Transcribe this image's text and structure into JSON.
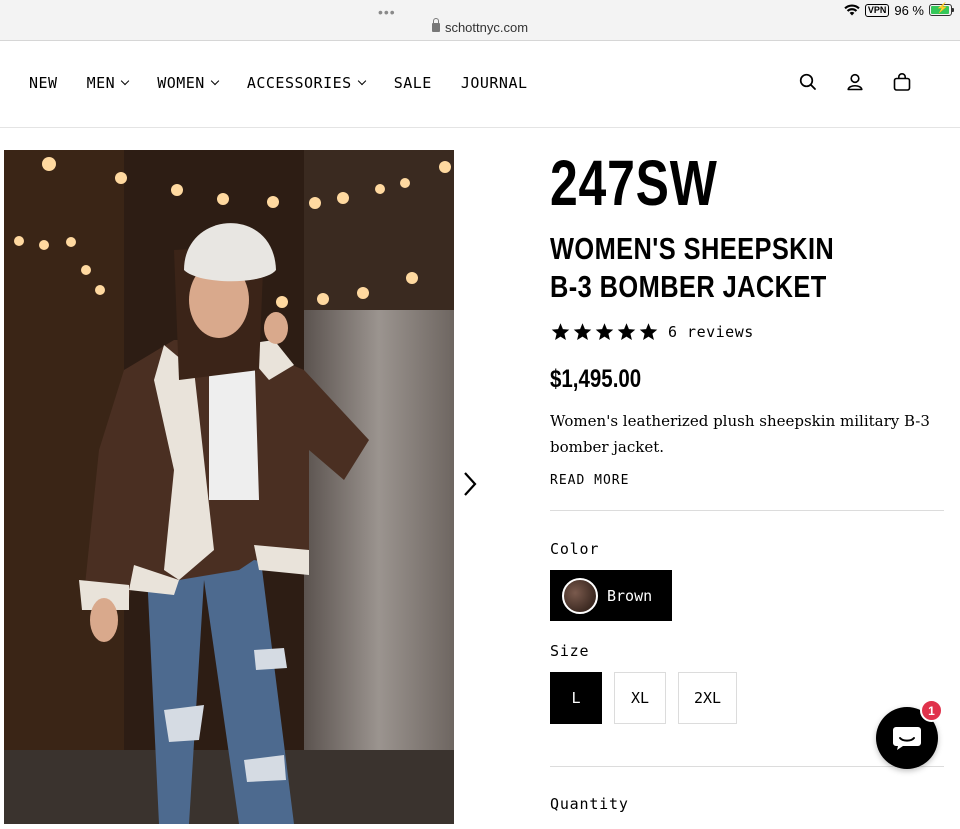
{
  "browser": {
    "dots": "•••",
    "url": "schottnyc.com",
    "vpn": "VPN",
    "battery": "96 %",
    "battery_level": 0.96
  },
  "nav": {
    "items": [
      {
        "label": "NEW",
        "has_dropdown": false
      },
      {
        "label": "MEN",
        "has_dropdown": true
      },
      {
        "label": "WOMEN",
        "has_dropdown": true
      },
      {
        "label": "ACCESSORIES",
        "has_dropdown": true
      },
      {
        "label": "SALE",
        "has_dropdown": false
      },
      {
        "label": "JOURNAL",
        "has_dropdown": false
      }
    ],
    "icons": [
      "search-icon",
      "account-icon",
      "cart-icon"
    ]
  },
  "product": {
    "model": "247SW",
    "title_line1": "WOMEN'S SHEEPSKIN",
    "title_line2": "B-3 BOMBER JACKET",
    "rating": 5,
    "reviews": "6 reviews",
    "price": "$1,495.00",
    "description": "Women's leatherized plush sheepskin military B-3 bomber jacket.",
    "read_more": "READ MORE",
    "color_label": "Color",
    "color": "Brown",
    "size_label": "Size",
    "sizes": [
      "L",
      "XL",
      "2XL"
    ],
    "selected_size": "L",
    "quantity_label": "Quantity"
  },
  "chat": {
    "badge": "1"
  },
  "colors": {
    "accent": "#000000",
    "badge": "#e0324b",
    "battery": "#34c759"
  }
}
